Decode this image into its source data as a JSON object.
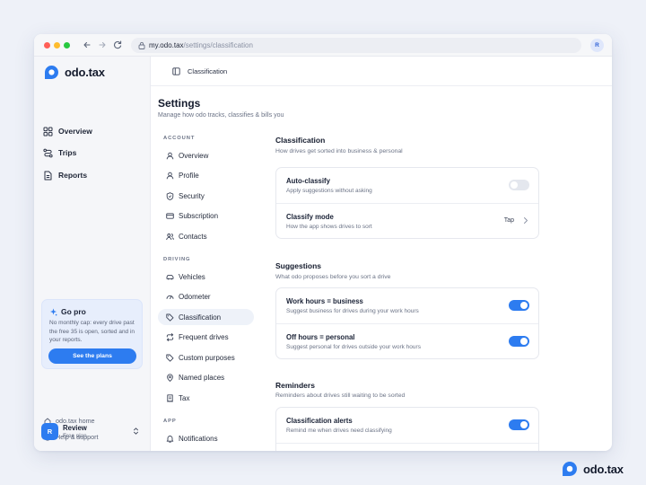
{
  "browser": {
    "url_host": "my.odo.tax",
    "url_path": "/settings/classification",
    "avatar_initial": "R"
  },
  "brand": {
    "name": "odo.tax",
    "accent": "#2d7cf0"
  },
  "sidebar": {
    "items": [
      {
        "label": "Overview",
        "icon": "grid-icon"
      },
      {
        "label": "Trips",
        "icon": "route-icon"
      },
      {
        "label": "Reports",
        "icon": "document-icon"
      }
    ],
    "gopro": {
      "title": "Go pro",
      "text": "No monthly cap: every drive past the free 35 is open, sorted and in your reports.",
      "button": "See the plans"
    },
    "links": [
      {
        "label": "odo.tax home",
        "icon": "home-icon"
      },
      {
        "label": "Help & support",
        "icon": "help-icon"
      }
    ],
    "account": {
      "initial": "R",
      "name": "Review",
      "plan": "Free plan"
    }
  },
  "topbar": {
    "title": "Classification"
  },
  "page": {
    "title": "Settings",
    "subtitle": "Manage how odo tracks, classifies & bills you"
  },
  "settings_nav": {
    "sections": [
      {
        "label": "ACCOUNT",
        "items": [
          "Overview",
          "Profile",
          "Security",
          "Subscription",
          "Contacts"
        ]
      },
      {
        "label": "DRIVING",
        "items": [
          "Vehicles",
          "Odometer",
          "Classification",
          "Frequent drives",
          "Custom purposes",
          "Named places",
          "Tax"
        ]
      },
      {
        "label": "APP",
        "items": [
          "Notifications"
        ]
      }
    ],
    "active": "Classification"
  },
  "main": {
    "classification": {
      "title": "Classification",
      "subtitle": "How drives get sorted into business & personal",
      "rows": [
        {
          "label": "Auto-classify",
          "sub": "Apply suggestions without asking",
          "toggle": false
        },
        {
          "label": "Classify mode",
          "sub": "How the app shows drives to sort",
          "value": "Tap"
        }
      ]
    },
    "suggestions": {
      "title": "Suggestions",
      "subtitle": "What odo proposes before you sort a drive",
      "rows": [
        {
          "label": "Work hours = business",
          "sub": "Suggest business for drives during your work hours",
          "toggle": true
        },
        {
          "label": "Off hours = personal",
          "sub": "Suggest personal for drives outside your work hours",
          "toggle": true
        }
      ]
    },
    "reminders": {
      "title": "Reminders",
      "subtitle": "Reminders about drives still waiting to be sorted",
      "rows": [
        {
          "label": "Classification alerts",
          "sub": "Remind me when drives need classifying",
          "toggle": true
        }
      ]
    }
  },
  "footer": {
    "brand": "odo.tax"
  }
}
